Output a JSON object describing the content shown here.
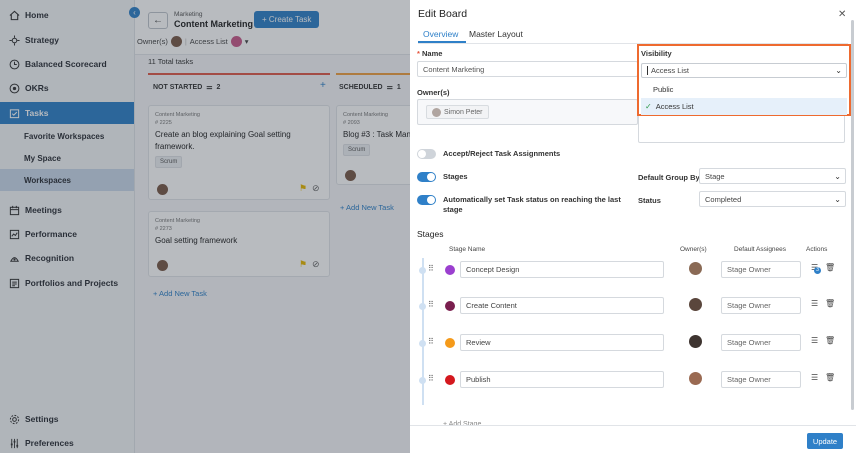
{
  "sidebar": {
    "items": [
      {
        "label": "Home",
        "icon": "home-icon"
      },
      {
        "label": "Strategy",
        "icon": "strategy-icon"
      },
      {
        "label": "Balanced Scorecard",
        "icon": "scorecard-icon"
      },
      {
        "label": "OKRs",
        "icon": "okr-icon"
      },
      {
        "label": "Tasks",
        "icon": "tasks-icon"
      },
      {
        "label": "Meetings",
        "icon": "meetings-icon"
      },
      {
        "label": "Performance",
        "icon": "performance-icon"
      },
      {
        "label": "Recognition",
        "icon": "recognition-icon"
      },
      {
        "label": "Portfolios and Projects",
        "icon": "portfolio-icon"
      },
      {
        "label": "Settings",
        "icon": "settings-icon"
      },
      {
        "label": "Preferences",
        "icon": "preferences-icon"
      }
    ],
    "sub_items": [
      "Favorite Workspaces",
      "My Space",
      "Workspaces"
    ]
  },
  "board": {
    "breadcrumb": "Marketing",
    "title": "Content Marketing",
    "create_label": "+ Create Task",
    "owners_label": "Owner(s)",
    "access_label": "Access List",
    "total": "11  Total tasks",
    "columns": [
      {
        "name": "NOT STARTED",
        "count": "2",
        "color": "#e05a4a"
      },
      {
        "name": "SCHEDULED",
        "count": "1",
        "color": "#f0a040"
      }
    ],
    "cards": [
      {
        "category": "Content Marketing",
        "number": "# 2225",
        "title": "Create an blog explaining Goal setting framework.",
        "tag": "Scrum"
      },
      {
        "category": "Content Marketing",
        "number": "# 2273",
        "title": "Goal setting framework",
        "tag": ""
      },
      {
        "category": "Content Marketing",
        "number": "# 2093",
        "title": "Blog #3 : Task Mana",
        "tag": "Scrum"
      }
    ],
    "add_task": "+ Add New Task"
  },
  "modal": {
    "title": "Edit Board",
    "tabs": [
      "Overview",
      "Master Layout"
    ],
    "name_label": "Name",
    "name_value": "Content Marketing",
    "owners_label": "Owner(s)",
    "owner_chip": "Simon Peter",
    "visibility": {
      "label": "Visibility",
      "value": "Access List",
      "options": [
        "Public",
        "Access List"
      ]
    },
    "toggles": [
      {
        "label": "Accept/Reject Task Assignments",
        "on": false
      },
      {
        "label": "Stages",
        "on": true
      },
      {
        "label": "Automatically set Task status on reaching the last stage",
        "on": true
      }
    ],
    "default_group_label": "Default Group By",
    "default_group_value": "Stage",
    "status_label": "Status",
    "status_value": "Completed",
    "stages_title": "Stages",
    "headers": {
      "stage_name": "Stage Name",
      "owner": "Owner(s)",
      "assignees": "Default Assignees",
      "actions": "Actions"
    },
    "stages": [
      {
        "name": "Concept Design",
        "color": "#9b3fcf",
        "assignee": "Stage Owner",
        "avatar": "#8a6a55",
        "badge": "3"
      },
      {
        "name": "Create Content",
        "color": "#7a1e4e",
        "assignee": "Stage Owner",
        "avatar": "#5a463c",
        "badge": ""
      },
      {
        "name": "Review",
        "color": "#f59a1a",
        "assignee": "Stage Owner",
        "avatar": "#3e3430",
        "badge": ""
      },
      {
        "name": "Publish",
        "color": "#d4181e",
        "assignee": "Stage Owner",
        "avatar": "#9a6a52",
        "badge": ""
      }
    ],
    "add_stage": "+ Add Stage",
    "update_label": "Update"
  }
}
